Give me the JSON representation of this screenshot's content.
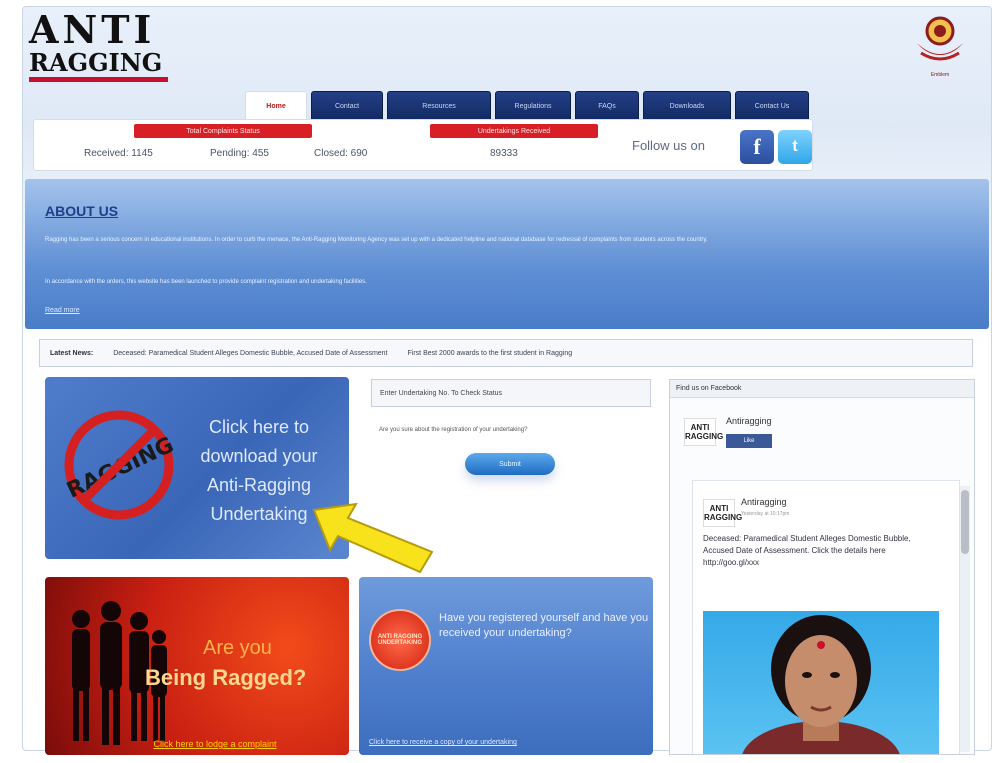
{
  "header": {
    "logo_line1": "ANTI",
    "logo_line2": "RAGGING",
    "emblem_caption": "Emblem"
  },
  "nav": {
    "tabs": [
      {
        "label": "Home",
        "active": true
      },
      {
        "label": "Contact"
      },
      {
        "label": "Resources"
      },
      {
        "label": "Regulations"
      },
      {
        "label": "FAQs"
      },
      {
        "label": "Downloads"
      },
      {
        "label": "Contact Us"
      }
    ]
  },
  "stats": {
    "complaints_label": "Total Complaints Status",
    "received": "Received: 1145",
    "pending": "Pending: 455",
    "closed": "Closed: 690",
    "undertakings_label": "Undertakings Received",
    "undertakings_count": "89333",
    "follow_us": "Follow us on",
    "facebook_glyph": "f",
    "twitter_glyph": "t"
  },
  "about": {
    "title": "ABOUT US",
    "para1": "Ragging has been a serious concern in educational institutions. In order to curb the menace, the Anti-Ragging Monitoring Agency was set up with a dedicated helpline and national database for redressal of complaints from students across the country.",
    "para2": "In accordance with the orders, this website has been launched to provide complaint registration and undertaking facilities.",
    "more": "Read more"
  },
  "ticker": {
    "label": "Latest News:",
    "items": [
      "Deceased: Paramedical Student Alleges Domestic Bubble, Accused Date of Assessment",
      "First Best 2000 awards to the first student in Ragging"
    ]
  },
  "download_banner": {
    "msg_line1": "Click here to",
    "msg_line2": "download your",
    "msg_line3": "Anti-Ragging",
    "msg_line4": "Undertaking",
    "stamp_text": "RAGGING"
  },
  "updates": {
    "input_label": "Enter Undertaking No. To Check Status",
    "note": "Are you sure about the registration of your undertaking?",
    "submit": "Submit"
  },
  "ragged_banner": {
    "line1": "Are you",
    "line2": "Being Ragged?",
    "link": "Click here to lodge a complaint"
  },
  "register_banner": {
    "stamp": "ANTI RAGGING UNDERTAKING",
    "question": "Have you registered yourself and have you received your undertaking?",
    "footer_link": "Click here to receive a copy of your undertaking"
  },
  "facebook_widget": {
    "header": "Find us on Facebook",
    "page_name": "Antiragging",
    "logo_text": "ANTI RAGGING",
    "like": "Like",
    "post_page_name": "Antiragging",
    "post_date": "Yesterday at 10:17pm",
    "post_body": "Deceased: Paramedical Student Alleges Domestic Bubble, Accused Date of Assessment. Click the details here http://goo.gl/xxx"
  },
  "colors": {
    "nav_blue": "#1b3574",
    "accent_red": "#d91f26",
    "about_blue": "#5f8fd4"
  }
}
